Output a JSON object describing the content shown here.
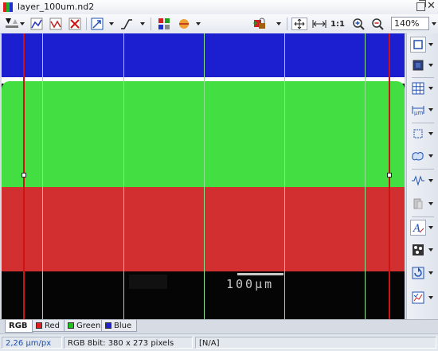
{
  "window": {
    "title": "layer_100um.nd2",
    "icon": "app-rgb-icon",
    "buttons": [
      "restore-icon",
      "close-icon"
    ]
  },
  "toolbar": {
    "ratio_label": "1:1",
    "zoom_value": "140%",
    "icons": [
      "lut-levels-icon",
      "lut-curve-icon",
      "lut-line-icon",
      "lut-reset-icon",
      "auto-scale-icon",
      "lut-curve-menu-icon",
      "channels-icon",
      "color-wheel-icon",
      "lock-image-icon",
      "fit-to-window-icon",
      "fit-width-icon",
      "zoom-in-icon",
      "zoom-out-icon"
    ]
  },
  "image": {
    "scalebar_label": "100µm",
    "bands": [
      {
        "name": "blue",
        "color": "#1b1fd0"
      },
      {
        "name": "green",
        "color": "#42de42"
      },
      {
        "name": "red",
        "color": "#d23030"
      },
      {
        "name": "black",
        "color": "#050505"
      }
    ]
  },
  "rightbar": {
    "icons": [
      "rectangle-select-icon",
      "fill-color-icon",
      "grid-icon",
      "micron-scale-icon",
      "crop-icon",
      "blob-icon",
      "waveform-icon",
      "layers-icon",
      "text-annotation-icon",
      "dots-pattern-icon",
      "refresh-icon",
      "chart-check-icon"
    ]
  },
  "tabs": [
    {
      "label": "RGB",
      "color": ""
    },
    {
      "label": "Red",
      "color": "#e02020"
    },
    {
      "label": "Green",
      "color": "#20c020"
    },
    {
      "label": "Blue",
      "color": "#2020d0"
    }
  ],
  "status": {
    "pixel_size": "2,26 µm/px",
    "image_info": "RGB 8bit: 380 x 273 pixels",
    "value": "[N/A]"
  }
}
